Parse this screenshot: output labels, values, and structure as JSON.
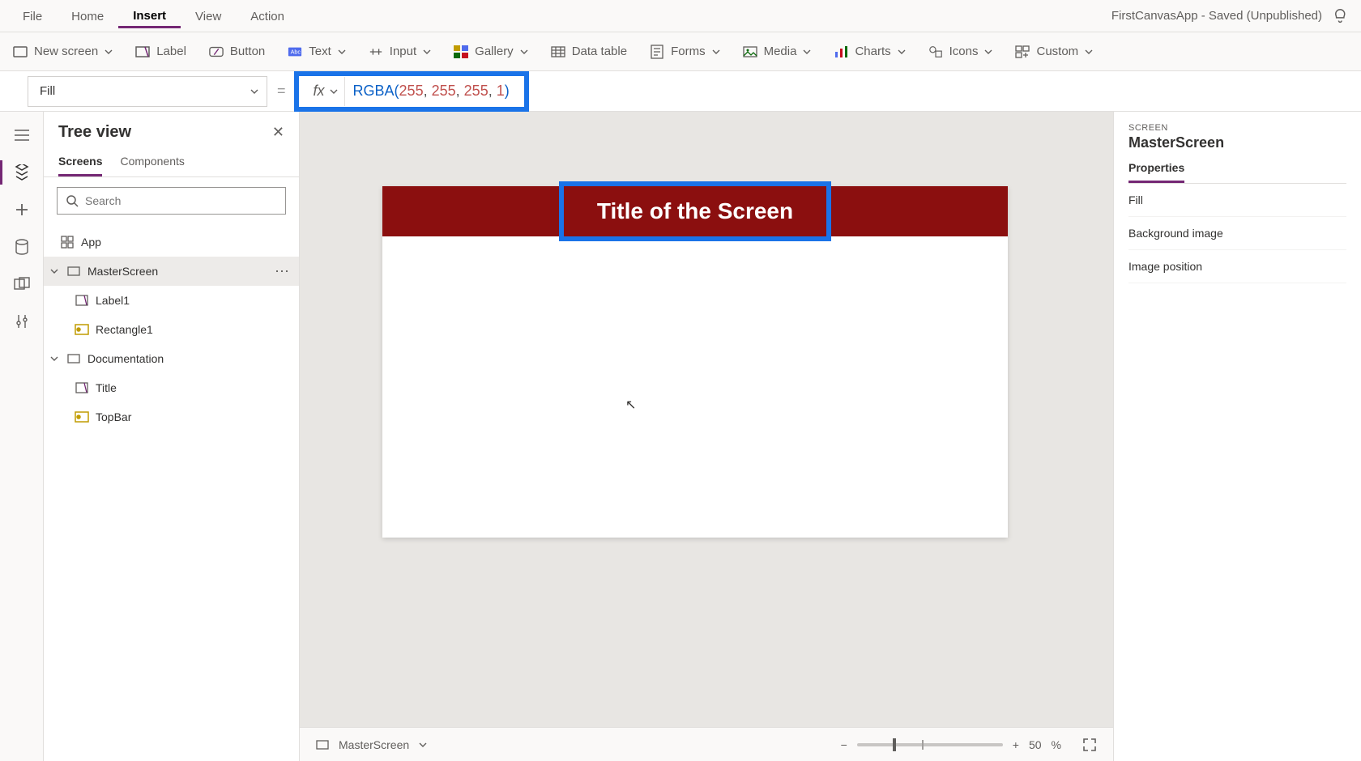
{
  "menu": {
    "items": [
      "File",
      "Home",
      "Insert",
      "View",
      "Action"
    ],
    "active": "Insert"
  },
  "app_title": "FirstCanvasApp - Saved (Unpublished)",
  "ribbon": {
    "new_screen": "New screen",
    "label": "Label",
    "button": "Button",
    "text": "Text",
    "input": "Input",
    "gallery": "Gallery",
    "data_table": "Data table",
    "forms": "Forms",
    "media": "Media",
    "charts": "Charts",
    "icons": "Icons",
    "custom": "Custom"
  },
  "formula": {
    "prop": "Fill",
    "fx": "fx",
    "fn": "RGBA",
    "args": [
      "255",
      "255",
      "255",
      "1"
    ]
  },
  "tree": {
    "title": "Tree view",
    "tabs": {
      "screens": "Screens",
      "components": "Components"
    },
    "search_placeholder": "Search",
    "app": "App",
    "nodes": {
      "master": "MasterScreen",
      "label1": "Label1",
      "rect1": "Rectangle1",
      "doc": "Documentation",
      "title_ctrl": "Title",
      "topbar_ctrl": "TopBar"
    }
  },
  "canvas": {
    "title_text": "Title of the Screen",
    "topbar_color": "#8b0f0f"
  },
  "status": {
    "screen": "MasterScreen",
    "zoom_value": "50",
    "zoom_pct": "%"
  },
  "props": {
    "kicker": "SCREEN",
    "screen_name": "MasterScreen",
    "tab_properties": "Properties",
    "rows": {
      "fill": "Fill",
      "bg": "Background image",
      "imgpos": "Image position"
    }
  }
}
